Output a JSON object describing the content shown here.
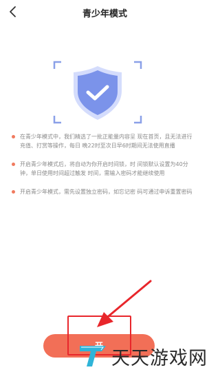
{
  "header": {
    "title": "青少年模式",
    "back_icon": "chevron-left-icon"
  },
  "hero": {
    "icon": "shield-check-icon",
    "frame_color": "#8aa0e8",
    "shield_color": "#7b93ea",
    "check_color": "#ffffff"
  },
  "bullets": [
    {
      "text": "在青少年模式中，我们精选了一批正能量内容呈 现在首页，且无法进行充值、打赏等操作，每日 晚22时至次日早6时期间无法使用直播"
    },
    {
      "text": "开启青少年模式后，将自动为你开启时间锁，时 间锁默认设置为40分钟，单日使用时间超过触发 时间，需输入密码才能继续使用"
    },
    {
      "text": "开启青少年模式，需先设置独立密码，如忘记密 码可通过申诉重置密码"
    }
  ],
  "bullet_color": "#f07a5e",
  "cta": {
    "label": "开",
    "color": "#f26f57"
  },
  "annotation": {
    "color": "#e8262b"
  },
  "watermark": {
    "text": "天天游戏网",
    "logo_color": "#2fb4d8"
  }
}
